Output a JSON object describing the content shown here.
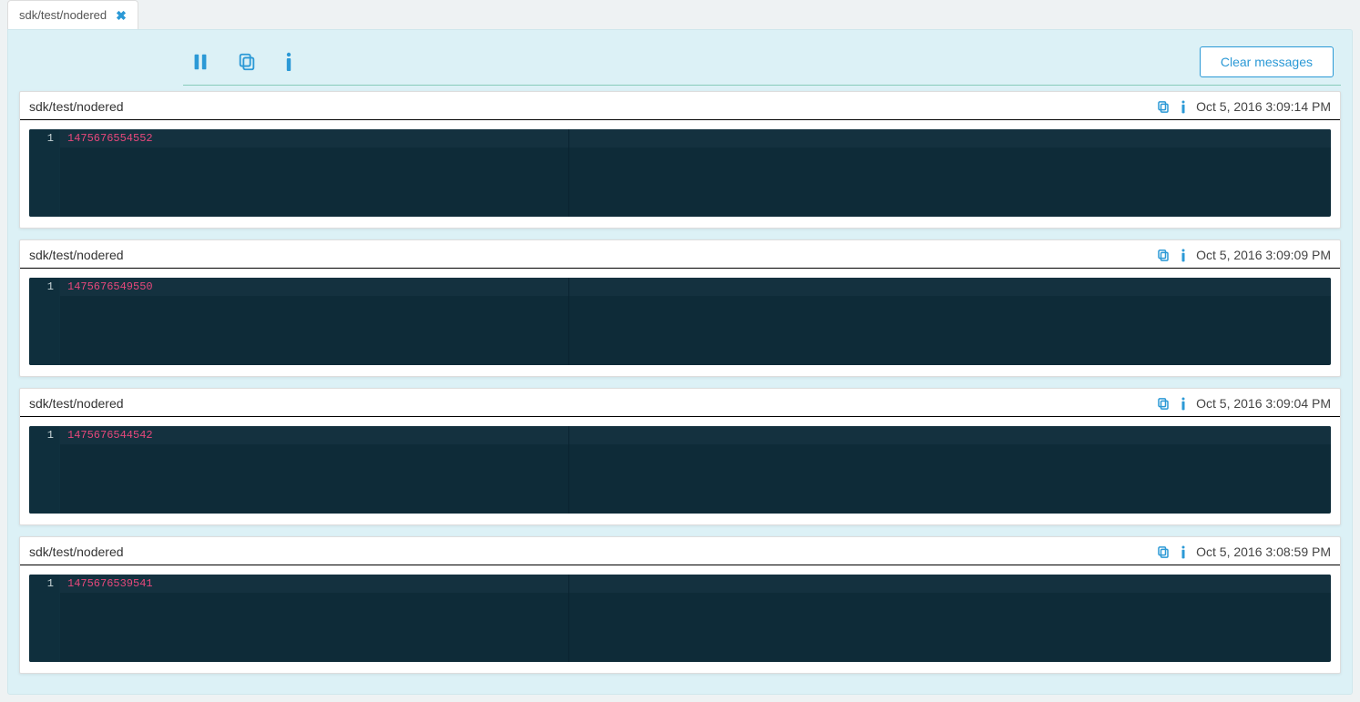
{
  "tab": {
    "label": "sdk/test/nodered"
  },
  "toolbar": {
    "clear_label": "Clear messages"
  },
  "messages": [
    {
      "topic": "sdk/test/nodered",
      "timestamp": "Oct 5, 2016 3:09:14 PM",
      "line_no": "1",
      "payload": "1475676554552"
    },
    {
      "topic": "sdk/test/nodered",
      "timestamp": "Oct 5, 2016 3:09:09 PM",
      "line_no": "1",
      "payload": "1475676549550"
    },
    {
      "topic": "sdk/test/nodered",
      "timestamp": "Oct 5, 2016 3:09:04 PM",
      "line_no": "1",
      "payload": "1475676544542"
    },
    {
      "topic": "sdk/test/nodered",
      "timestamp": "Oct 5, 2016 3:08:59 PM",
      "line_no": "1",
      "payload": "1475676539541"
    }
  ]
}
